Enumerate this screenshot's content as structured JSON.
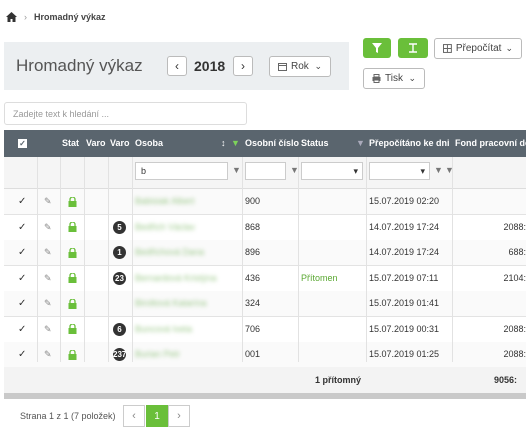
{
  "breadcrumb": {
    "current": "Hromadný výkaz"
  },
  "page_title": "Hromadný výkaz",
  "year": "2018",
  "period_select": "Rok",
  "toolbar": {
    "recalc_label": "Přepočítat",
    "print_label": "Tisk"
  },
  "search": {
    "placeholder": "Zadejte text k hledání ..."
  },
  "columns": {
    "status_short": "Stat",
    "warn1": "Varo",
    "warn2": "Varo",
    "osoba": "Osoba",
    "osobni_cislo": "Osobní číslo",
    "status": "Status",
    "prepocitano": "Přepočítáno ke dni",
    "fond": "Fond pracovní do"
  },
  "filter": {
    "osoba_value": "b"
  },
  "rows": [
    {
      "badge": "",
      "name": "Babisiak Albert",
      "number": "900",
      "status": "",
      "date": "15.07.2019 02:20",
      "fond": ""
    },
    {
      "badge": "5",
      "name": "Bedřich Václav",
      "number": "868",
      "status": "",
      "date": "14.07.2019 17:24",
      "fond": "2088:"
    },
    {
      "badge": "1",
      "name": "Bedřichová Dana",
      "number": "896",
      "status": "",
      "date": "14.07.2019 17:24",
      "fond": "688:"
    },
    {
      "badge": "23",
      "name": "Bernardová Kristýna",
      "number": "436",
      "status": "Přítomen",
      "date": "15.07.2019 07:11",
      "fond": "2104:"
    },
    {
      "badge": "",
      "name": "Biroltová Katarína",
      "number": "324",
      "status": "",
      "date": "15.07.2019 01:41",
      "fond": ""
    },
    {
      "badge": "6",
      "name": "Buncová Iveta",
      "number": "706",
      "status": "",
      "date": "15.07.2019 00:31",
      "fond": "2088:"
    },
    {
      "badge": "237",
      "name": "Burian Petr",
      "number": "001",
      "status": "",
      "date": "15.07.2019 01:25",
      "fond": "2088:"
    }
  ],
  "footer": {
    "present": "1 přítomný",
    "fond_total": "9056:"
  },
  "pager": {
    "info": "Strana 1 z 1 (7 položek)",
    "page": "1"
  },
  "colors": {
    "header_bg": "#5a656e",
    "accent": "#6abf3a",
    "status_green": "#5aa832"
  }
}
